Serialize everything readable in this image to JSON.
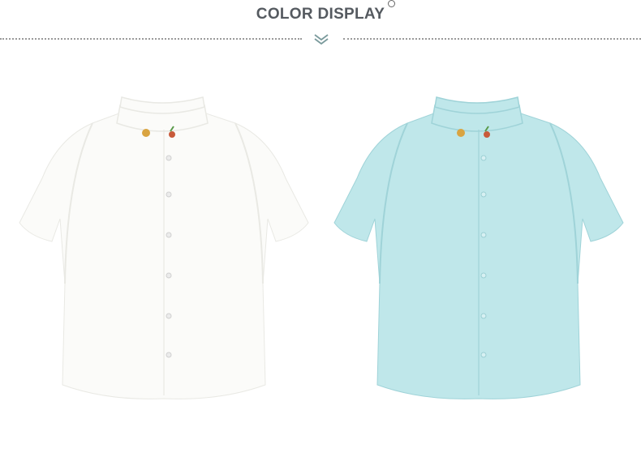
{
  "header": {
    "title": "COLOR DISPLAY",
    "accent_color": "#6a8a8c"
  },
  "products": [
    {
      "icon": "white-shirt-image",
      "fabric_color": "#fbfbf9",
      "shade_color": "#e9e9e4"
    },
    {
      "icon": "mint-shirt-image",
      "fabric_color": "#bfe7ea",
      "shade_color": "#9fd3d8"
    }
  ]
}
